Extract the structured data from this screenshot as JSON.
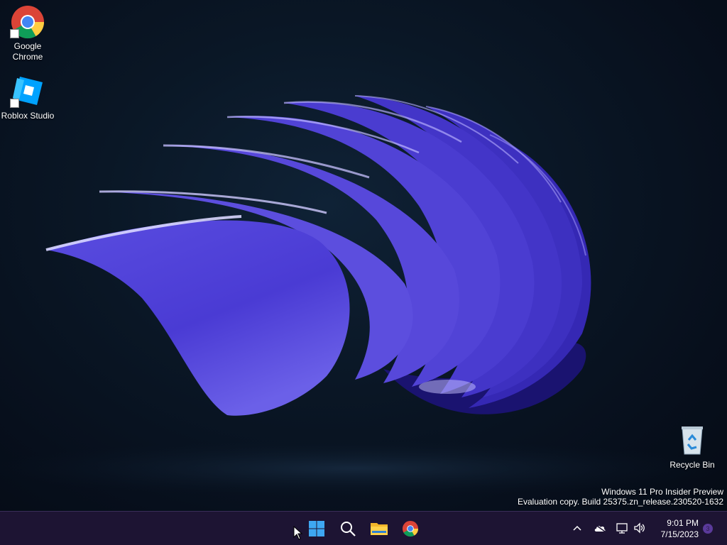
{
  "desktop_icons": [
    {
      "label_line1": "Google",
      "label_line2": "Chrome",
      "icon": "chrome-icon"
    },
    {
      "label_line1": "Roblox Studio",
      "label_line2": "",
      "icon": "roblox-studio-icon"
    },
    {
      "label_line1": "Recycle Bin",
      "label_line2": "",
      "icon": "recycle-bin-icon"
    }
  ],
  "watermark": {
    "line1": "Windows 11 Pro Insider Preview",
    "line2": "Evaluation copy. Build 25375.zn_release.230520-1632"
  },
  "taskbar": {
    "pinned": [
      "start-icon",
      "search-icon",
      "file-explorer-icon",
      "chrome-icon"
    ],
    "tray_icons": [
      "chevron-up-icon",
      "onedrive-icon",
      "network-icon",
      "volume-icon"
    ],
    "time": "9:01 PM",
    "date": "7/15/2023",
    "notification_count": "3"
  },
  "colors": {
    "taskbar_bg": "#1d1433",
    "wallpaper_accent": "#4f3fd0",
    "desktop_bg": "#0a1726"
  }
}
